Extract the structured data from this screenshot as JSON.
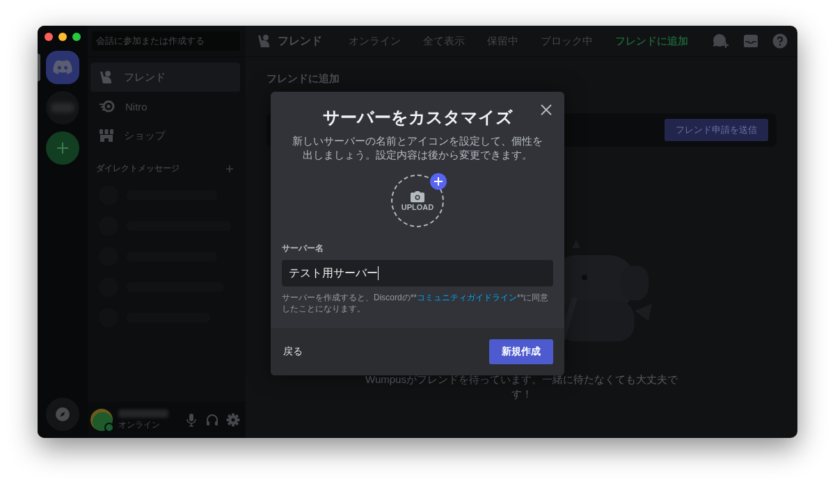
{
  "server_rail": {
    "items": [
      {
        "kind": "home",
        "selected": true
      },
      {
        "kind": "server",
        "selected": false
      },
      {
        "kind": "add",
        "selected": false
      }
    ]
  },
  "search": {
    "placeholder": "会話に参加または作成する"
  },
  "sidebar": {
    "items": [
      {
        "label": "フレンド",
        "kind": "friends",
        "selected": true
      },
      {
        "label": "Nitro",
        "kind": "nitro",
        "selected": false
      },
      {
        "label": "ショップ",
        "kind": "shop",
        "selected": false
      }
    ],
    "dm_header": "ダイレクトメッセージ"
  },
  "user_panel": {
    "status": "オンライン"
  },
  "topbar": {
    "title": "フレンド",
    "tabs": [
      {
        "label": "オンライン",
        "kind": "tab",
        "selected": false
      },
      {
        "label": "全て表示",
        "kind": "tab",
        "selected": false
      },
      {
        "label": "保留中",
        "kind": "tab",
        "selected": false
      },
      {
        "label": "ブロック中",
        "kind": "tab",
        "selected": false
      },
      {
        "label": "フレンドに追加",
        "kind": "add_friend",
        "selected": true
      }
    ]
  },
  "add_friend": {
    "title": "フレンドに追加",
    "button": "フレンド申請を送信"
  },
  "empty_state": {
    "text": "Wumpusがフレンドを待っています。一緒に待たなくても大丈夫です！"
  },
  "modal": {
    "title": "サーバーをカスタマイズ",
    "description": "新しいサーバーの名前とアイコンを設定して、個性を出しましょう。設定内容は後から変更できます。",
    "upload_label": "UPLOAD",
    "field_label": "サーバー名",
    "field_value": "テスト用サーバー",
    "legal_before": "サーバーを作成すると、Discordの**",
    "legal_link": "コミュニティガイドライン",
    "legal_after": "**に同意したことになります。",
    "back": "戻る",
    "create": "新規作成"
  }
}
